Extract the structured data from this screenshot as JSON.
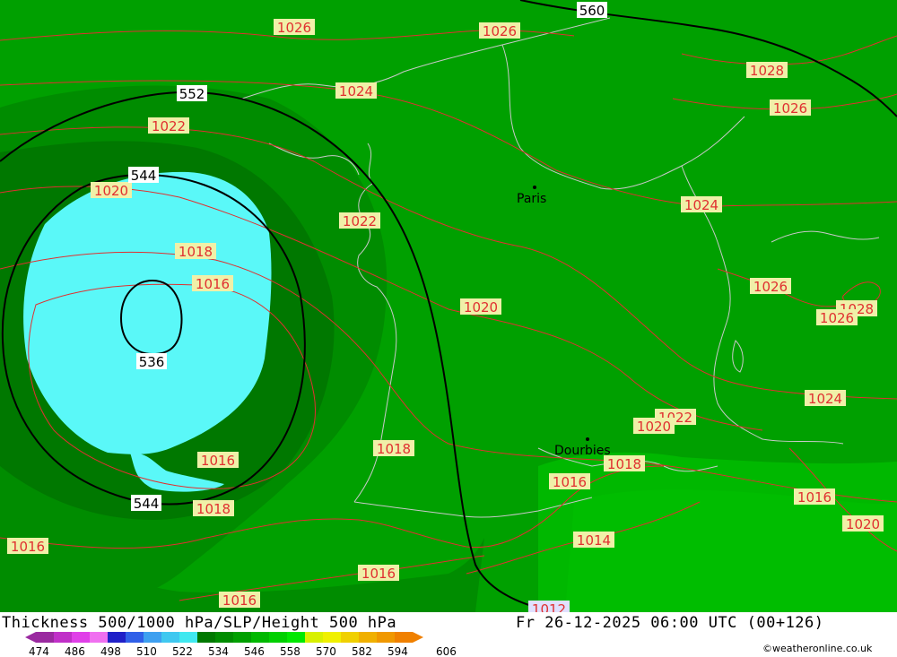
{
  "map": {
    "colors": {
      "band_546_552": "#00a000",
      "band_540_546": "#008c00",
      "band_534_540": "#007800",
      "band_528_534": "#5af8f8",
      "band_552_558": "#00b800",
      "isobar": "#e03030",
      "height_line": "#000000",
      "border": "#c8c8c8"
    },
    "isobar_labels": [
      "1026",
      "1026",
      "1028",
      "1026",
      "1024",
      "1022",
      "1020",
      "1022",
      "1018",
      "1016",
      "1024",
      "1026",
      "1028",
      "1026",
      "1020",
      "1024",
      "1022",
      "1020",
      "1018",
      "1016",
      "1016",
      "1018",
      "1016",
      "1018",
      "1020",
      "1014",
      "1016",
      "1016",
      "1016",
      "1012"
    ],
    "height_labels": [
      "560",
      "552",
      "544",
      "536",
      "544"
    ],
    "cities": [
      {
        "name": "Paris"
      },
      {
        "name": "Dourbies"
      }
    ]
  },
  "footer": {
    "title": "Thickness 500/1000 hPa/SLP/Height 500 hPa",
    "datetime": "Fr 26-12-2025 06:00 UTC (00+126)",
    "credit": "©weatheronline.co.uk"
  },
  "colorbar": {
    "ticks": [
      "474",
      "486",
      "498",
      "510",
      "522",
      "534",
      "546",
      "558",
      "570",
      "582",
      "594",
      "606"
    ],
    "colors": [
      "#9a2aa0",
      "#c030c8",
      "#e040e8",
      "#f070f0",
      "#2020c8",
      "#3060e8",
      "#3ea0f0",
      "#40c8f0",
      "#40e8f0",
      "#007800",
      "#008c00",
      "#00a000",
      "#00b800",
      "#00d000",
      "#00e800",
      "#d8f000",
      "#f0f000",
      "#f0d000",
      "#f0b000",
      "#f09800",
      "#f08000"
    ]
  }
}
